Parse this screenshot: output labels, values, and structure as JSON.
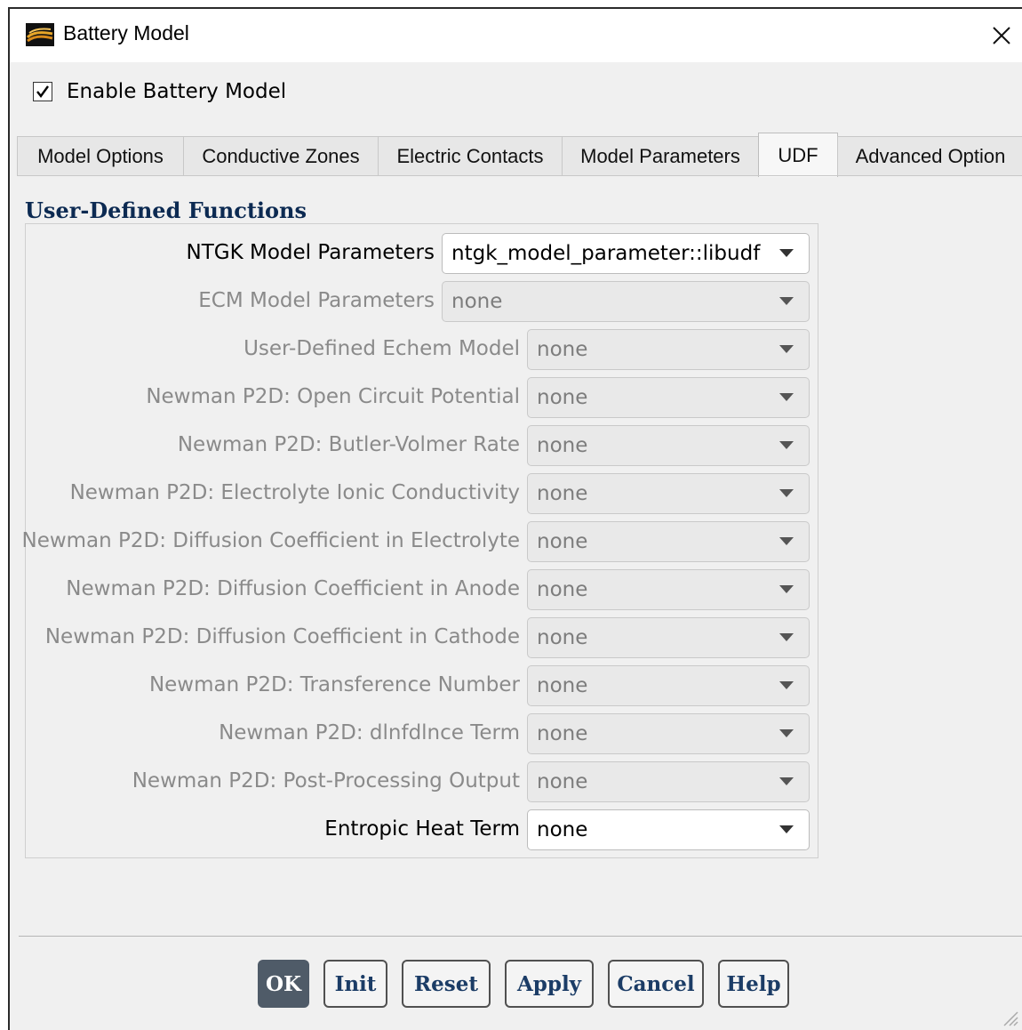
{
  "window": {
    "title": "Battery Model"
  },
  "enable_battery": {
    "label": "Enable Battery Model",
    "checked": true
  },
  "tabs": [
    {
      "label": "Model Options",
      "active": false
    },
    {
      "label": "Conductive Zones",
      "active": false
    },
    {
      "label": "Electric Contacts",
      "active": false
    },
    {
      "label": "Model Parameters",
      "active": false
    },
    {
      "label": "UDF",
      "active": true
    },
    {
      "label": "Advanced Option",
      "active": false
    }
  ],
  "section": {
    "title": "User-Defined Functions"
  },
  "udf_rows": [
    {
      "label": "NTGK Model Parameters",
      "value": "ntgk_model_parameter::libudf",
      "enabled": true
    },
    {
      "label": "ECM Model Parameters",
      "value": "none",
      "enabled": false
    },
    {
      "label": "User-Defined Echem Model",
      "value": "none",
      "enabled": false
    },
    {
      "label": "Newman P2D: Open Circuit Potential",
      "value": "none",
      "enabled": false
    },
    {
      "label": "Newman P2D: Butler-Volmer Rate",
      "value": "none",
      "enabled": false
    },
    {
      "label": "Newman P2D: Electrolyte Ionic Conductivity",
      "value": "none",
      "enabled": false
    },
    {
      "label": "Newman P2D: Diffusion Coefficient in Electrolyte",
      "value": "none",
      "enabled": false
    },
    {
      "label": "Newman P2D: Diffusion Coefficient in Anode",
      "value": "none",
      "enabled": false
    },
    {
      "label": "Newman P2D: Diffusion Coefficient in Cathode",
      "value": "none",
      "enabled": false
    },
    {
      "label": "Newman P2D: Transference Number",
      "value": "none",
      "enabled": false
    },
    {
      "label": "Newman P2D: dlnfdlnce Term",
      "value": "none",
      "enabled": false
    },
    {
      "label": "Newman P2D: Post-Processing Output",
      "value": "none",
      "enabled": false
    },
    {
      "label": "Entropic Heat Term",
      "value": "none",
      "enabled": true
    }
  ],
  "buttons": {
    "ok": "OK",
    "init": "Init",
    "reset": "Reset",
    "apply": "Apply",
    "cancel": "Cancel",
    "help": "Help"
  },
  "icons": {
    "app": "fluent-app-icon",
    "close": "close-icon",
    "check": "check-icon",
    "dropdown": "chevron-down-icon",
    "resize": "resize-grip-icon"
  },
  "colors": {
    "section_title": "#0c2a52",
    "button_text": "#1b3c66",
    "primary_button": "#4f5b68",
    "disabled_text": "#8a8a8a"
  }
}
